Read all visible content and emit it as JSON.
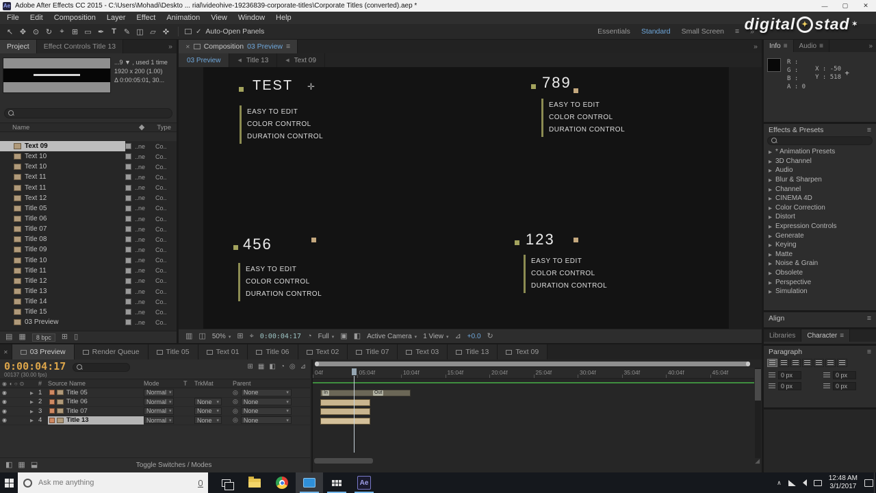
{
  "titlebar": {
    "app": "Ae",
    "title": "Adobe After Effects CC 2015 - C:\\Users\\Mohadi\\Deskto ... rial\\videohive-19236839-corporate-titles\\Corporate Titles (converted).aep *"
  },
  "menubar": {
    "items": [
      "File",
      "Edit",
      "Composition",
      "Layer",
      "Effect",
      "Animation",
      "View",
      "Window",
      "Help"
    ]
  },
  "toolbar": {
    "auto_open_label": "Auto-Open Panels",
    "workspaces": [
      {
        "label": "Essentials"
      },
      {
        "label": "Standard",
        "active": true
      },
      {
        "label": "Small Screen"
      }
    ]
  },
  "watermark": {
    "part1": "digital",
    "part2": "stad"
  },
  "project_panel": {
    "tabs": [
      {
        "label": "Project",
        "active": true
      },
      {
        "label": "Effect Controls Title 13"
      }
    ],
    "info1": "...9 ▼ , used 1 time",
    "info2": "1920 x 200 (1.00)",
    "info3": "Δ 0:00:05:01, 30...",
    "col_name": "Name",
    "col_type": "Type",
    "rows": [
      {
        "name": "Text 09",
        "mid": "..ne",
        "type": "Co..",
        "selected": true
      },
      {
        "name": "Text 10",
        "mid": "..ne",
        "type": "Co.."
      },
      {
        "name": "Text 10",
        "mid": "..ne",
        "type": "Co.."
      },
      {
        "name": "Text 11",
        "mid": "..ne",
        "type": "Co.."
      },
      {
        "name": "Text 11",
        "mid": "..ne",
        "type": "Co.."
      },
      {
        "name": "Text 12",
        "mid": "..ne",
        "type": "Co.."
      },
      {
        "name": "Title 05",
        "mid": "..ne",
        "type": "Co.."
      },
      {
        "name": "Title 06",
        "mid": "..ne",
        "type": "Co.."
      },
      {
        "name": "Title 07",
        "mid": "..ne",
        "type": "Co.."
      },
      {
        "name": "Title 08",
        "mid": "..ne",
        "type": "Co.."
      },
      {
        "name": "Title 09",
        "mid": "..ne",
        "type": "Co.."
      },
      {
        "name": "Title 10",
        "mid": "..ne",
        "type": "Co.."
      },
      {
        "name": "Title 11",
        "mid": "..ne",
        "type": "Co.."
      },
      {
        "name": "Title 12",
        "mid": "..ne",
        "type": "Co.."
      },
      {
        "name": "Title 13",
        "mid": "..ne",
        "type": "Co.."
      },
      {
        "name": "Title 14",
        "mid": "..ne",
        "type": "Co.."
      },
      {
        "name": "Title 15",
        "mid": "..ne",
        "type": "Co.."
      },
      {
        "name": "03 Preview",
        "mid": "..ne",
        "type": "Co.."
      }
    ],
    "footer_depth": "8 bpc"
  },
  "composition_panel": {
    "tab_label": "Composition",
    "tab_comp": "03 Preview",
    "view_tabs": [
      {
        "label": "03 Preview",
        "active": true
      },
      {
        "label": "Title 13"
      },
      {
        "label": "Text 09"
      }
    ],
    "titles": [
      {
        "big": "TEST",
        "lines": [
          "EASY TO EDIT",
          "COLOR CONTROL",
          "DURATION CONTROL"
        ]
      },
      {
        "big": "789",
        "lines": [
          "EASY TO EDIT",
          "COLOR CONTROL",
          "DURATION CONTROL"
        ]
      },
      {
        "big": "456",
        "lines": [
          "EASY TO EDIT",
          "COLOR CONTROL",
          "DURATION CONTROL"
        ]
      },
      {
        "big": "123",
        "lines": [
          "EASY TO EDIT",
          "COLOR CONTROL",
          "DURATION CONTROL"
        ]
      }
    ],
    "bottom": {
      "zoom": "50%",
      "timecode": "0:00:04:17",
      "resolution": "Full",
      "camera": "Active Camera",
      "view": "1 View",
      "exposure": "+0.0"
    }
  },
  "info_panel": {
    "tabs": [
      {
        "label": "Info",
        "active": true
      },
      {
        "label": "Audio"
      }
    ],
    "r": "R :",
    "g": "G :",
    "b": "B :",
    "a": "A : 0",
    "x": "X : -50",
    "y": "Y : 518"
  },
  "effects_panel": {
    "title": "Effects & Presets",
    "categories": [
      "* Animation Presets",
      "3D Channel",
      "Audio",
      "Blur & Sharpen",
      "Channel",
      "CINEMA 4D",
      "Color Correction",
      "Distort",
      "Expression Controls",
      "Generate",
      "Keying",
      "Matte",
      "Noise & Grain",
      "Obsolete",
      "Perspective",
      "Simulation"
    ]
  },
  "align_panel": {
    "title": "Align"
  },
  "libraries_panel": {
    "tabs": [
      {
        "label": "Libraries"
      },
      {
        "label": "Character",
        "active": true
      }
    ]
  },
  "paragraph_panel": {
    "title": "Paragraph",
    "fields": [
      "0 px",
      "0 px",
      "0 px",
      "0 px"
    ]
  },
  "timeline": {
    "tabs": [
      {
        "label": "03 Preview",
        "active": true
      },
      {
        "label": "Render Queue"
      },
      {
        "label": "Title 05"
      },
      {
        "label": "Text 01"
      },
      {
        "label": "Title 06"
      },
      {
        "label": "Text 02"
      },
      {
        "label": "Title 07"
      },
      {
        "label": "Text 03"
      },
      {
        "label": "Title 13"
      },
      {
        "label": "Text 09"
      }
    ],
    "timecode": "0:00:04:17",
    "frame_info": "00137 (30.00 fps)",
    "headers": {
      "num": "#",
      "source": "Source Name",
      "mode": "Mode",
      "t": "T",
      "trkmat": "TrkMat",
      "parent": "Parent"
    },
    "layers": [
      {
        "num": "1",
        "name": "Title 05",
        "mode": "Normal",
        "parent": "None"
      },
      {
        "num": "2",
        "name": "Title 06",
        "mode": "Normal",
        "trkmat": "None",
        "parent": "None"
      },
      {
        "num": "3",
        "name": "Title 07",
        "mode": "Normal",
        "trkmat": "None",
        "parent": "None"
      },
      {
        "num": "4",
        "name": "Title 13",
        "mode": "Normal",
        "trkmat": "None",
        "parent": "None",
        "selected": true
      }
    ],
    "in_label": "In",
    "out_label": "Out",
    "ruler": [
      "04f",
      "05:04f",
      "10:04f",
      "15:04f",
      "20:04f",
      "25:04f",
      "30:04f",
      "35:04f",
      "40:04f",
      "45:04f"
    ],
    "toggle_label": "Toggle Switches / Modes"
  },
  "taskbar": {
    "search_placeholder": "Ask me anything",
    "time": "12:48 AM",
    "date": "3/1/2017"
  }
}
